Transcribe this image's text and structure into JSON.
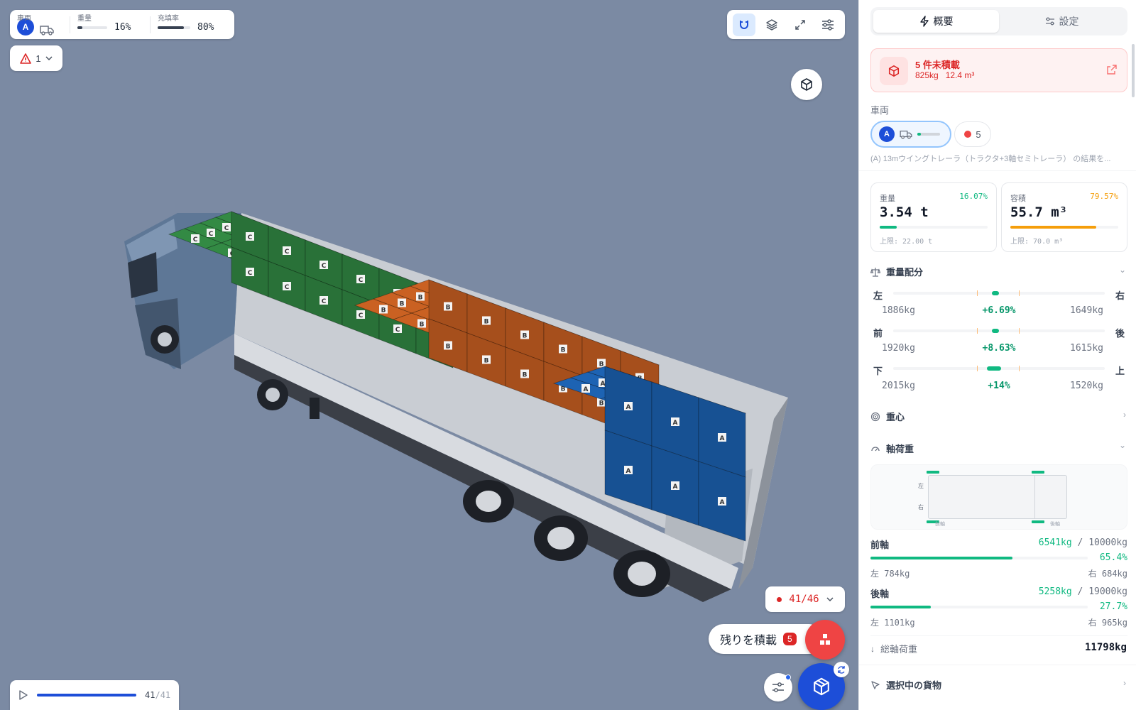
{
  "app": {
    "topbar": {
      "vehicle_label": "車両",
      "vehicle_avatar": "A",
      "weight_label": "重量",
      "weight_value": "16%",
      "fill_label": "充填率",
      "fill_value": "80%",
      "weight_fraction": 0.16,
      "fill_fraction": 0.8
    },
    "warning_count": "1",
    "toolbar": {
      "icons": [
        "magnet-icon",
        "layers-icon",
        "expand-icon",
        "sliders-icon"
      ]
    },
    "scene": {
      "box_labels": {
        "green": "C",
        "orange": "B",
        "blue": "A"
      },
      "colors": {
        "green": "#2e7d3e",
        "orange": "#b8581f",
        "blue": "#1a5aa3",
        "background": "#7b8aa3"
      }
    },
    "progress_counter": "41/46",
    "load_remaining": {
      "label": "残りを積載",
      "count": "5"
    },
    "playback": {
      "current": "41",
      "total": "41",
      "separator": "/",
      "fraction": 1.0
    }
  },
  "panel": {
    "tabs": [
      {
        "label": "概要",
        "icon": "lightning-icon",
        "active": true
      },
      {
        "label": "設定",
        "icon": "sliders-icon",
        "active": false
      }
    ],
    "unloaded_alert": {
      "title": "5 件未積載",
      "weight": "825kg",
      "volume": "12.4 m³"
    },
    "vehicle_section_label": "車両",
    "vehicle_chip": {
      "avatar": "A",
      "fill_fraction": 0.16
    },
    "unloaded_chip_count": "5",
    "vehicle_description": "(A) 13mウイングトレーラ（トラクタ+3軸セミトレーラ） の結果を...",
    "stats": {
      "weight": {
        "label": "重量",
        "percent": "16.07%",
        "value": "3.54 t",
        "limit": "上限: 22.00 t",
        "fraction": 0.1607,
        "color": "#10b981"
      },
      "volume": {
        "label": "容積",
        "percent": "79.57%",
        "value": "55.7 m³",
        "limit": "上限: 70.0 m³",
        "fraction": 0.7957,
        "color": "#f59e0b"
      }
    },
    "weight_distribution": {
      "title": "重量配分",
      "rows": [
        {
          "left_label": "左",
          "right_label": "右",
          "left_value": "1886kg",
          "diff": "+6.69%",
          "right_value": "1649kg"
        },
        {
          "left_label": "前",
          "right_label": "後",
          "left_value": "1920kg",
          "diff": "+8.63%",
          "right_value": "1615kg"
        },
        {
          "left_label": "下",
          "right_label": "上",
          "left_value": "2015kg",
          "diff": "+14%",
          "right_value": "1520kg"
        }
      ]
    },
    "center_of_gravity_title": "重心",
    "axle_load": {
      "title": "軸荷重",
      "diagram_labels": {
        "left": "左",
        "right": "右",
        "front": "前軸",
        "rear": "後軸"
      },
      "front": {
        "label": "前軸",
        "load": "6541kg",
        "sep": "/",
        "max": "10000kg",
        "percent": "65.4%",
        "fraction": 0.654,
        "left": "左 784kg",
        "right": "右 684kg"
      },
      "rear": {
        "label": "後軸",
        "load": "5258kg",
        "sep": "/",
        "max": "19000kg",
        "percent": "27.7%",
        "fraction": 0.277,
        "left": "左 1101kg",
        "right": "右 965kg"
      },
      "total_label": "総軸荷重",
      "total_value": "11798kg"
    },
    "selected_cargo_title": "選択中の貨物"
  }
}
